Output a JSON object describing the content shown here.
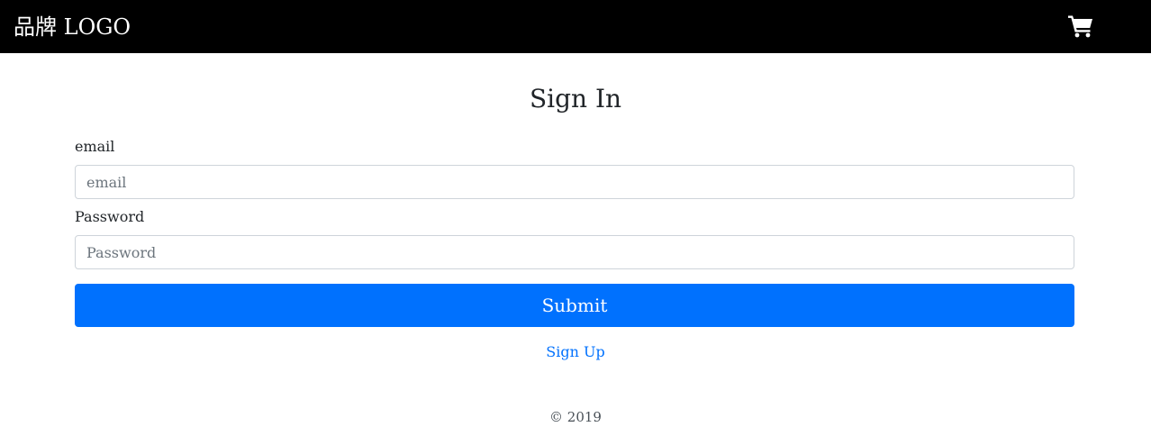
{
  "navbar": {
    "brand": "品牌 LOGO",
    "cart_icon": "shopping-cart-icon",
    "background_color": "#000000"
  },
  "form": {
    "title": "Sign In",
    "email_label": "email",
    "email_placeholder": "email",
    "email_value": "",
    "password_label": "Password",
    "password_placeholder": "Password",
    "password_value": "",
    "submit_label": "Submit",
    "submit_color": "#0071fe",
    "signup_link": "Sign Up"
  },
  "footer": {
    "copyright": "© 2019"
  }
}
